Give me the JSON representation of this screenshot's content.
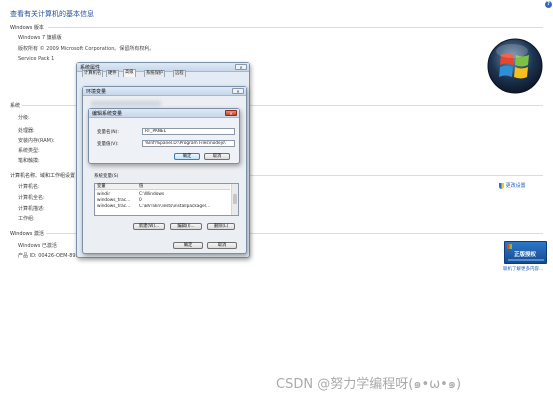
{
  "help": {
    "glyph": "?"
  },
  "page": {
    "title": "查看有关计算机的基本信息",
    "edition": {
      "header": "Windows 版本",
      "name": "Windows 7 旗舰版",
      "copyright": "版权所有 © 2009 Microsoft Corporation。保留所有权利。",
      "service_pack": "Service Pack 1"
    },
    "system": {
      "header": "系统",
      "rating": "分级:",
      "processor": "处理器:",
      "ram": "安装内存(RAM):",
      "type": "系统类型:",
      "pen": "笔和触摸:"
    },
    "computer": {
      "header": "计算机名称、域和工作组设置",
      "name": "计算机名:",
      "full": "计算机全名:",
      "desc": "计算机描述:",
      "workgroup": "工作组:",
      "change_link": "更改设置"
    },
    "activation": {
      "header": "Windows 激活",
      "status": "Windows 已激活",
      "product_id": "产品 ID: 00426-OEM-8992"
    },
    "genuine": {
      "badge_line1": "正版授权",
      "link": "联机了解更多内容..."
    }
  },
  "sysprops": {
    "title": "系统属性",
    "tabs": [
      "计算机名",
      "硬件",
      "高级",
      "系统保护",
      "远程"
    ]
  },
  "envvars": {
    "title": "环境变量",
    "system_vars_label": "系统变量(S)",
    "col_var": "变量",
    "col_val": "值",
    "rows": [
      {
        "name": "windir",
        "value": "C:\\Windows"
      },
      {
        "name": "windows_trac...",
        "value": "0"
      },
      {
        "name": "windows_trac...",
        "value": "C:\\BVTBin\\Tests\\installpackage\\..."
      }
    ],
    "new_btn": "新建(W)...",
    "edit_btn": "编辑(I)...",
    "delete_btn": "删除(L)",
    "ok_btn": "确定",
    "cancel_btn": "取消"
  },
  "editvar": {
    "title": "编辑系统变量",
    "name_label": "变量名(N):",
    "name_value": "RT_PANEL",
    "value_label": "变量值(V):",
    "value_value": "%Inf\\%panel.D:\\Program Files\\nodejs\\",
    "ok_btn": "确定",
    "cancel_btn": "取消"
  },
  "watermark": "CSDN @努力学编程呀(๑•ω•๑)"
}
